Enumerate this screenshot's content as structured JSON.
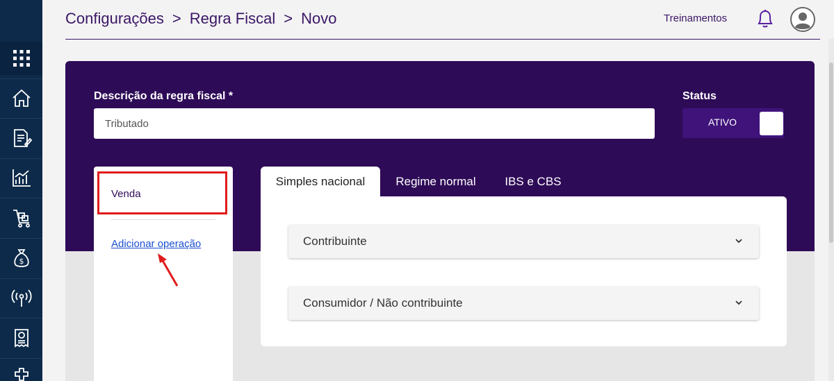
{
  "sidebar": {
    "items": [
      {
        "icon": "apps-grid-icon"
      },
      {
        "icon": "home-icon"
      },
      {
        "icon": "document-edit-icon"
      },
      {
        "icon": "analytics-chart-icon"
      },
      {
        "icon": "cart-icon"
      },
      {
        "icon": "money-bag-icon"
      },
      {
        "icon": "broadcast-antenna-icon"
      },
      {
        "icon": "receipt-icon"
      },
      {
        "icon": "puzzle-icon"
      }
    ]
  },
  "header": {
    "breadcrumb": [
      "Configurações",
      "Regra Fiscal",
      "Novo"
    ],
    "separator": ">",
    "treinamentos": "Treinamentos",
    "bell_icon": "bell-icon",
    "avatar_icon": "user-avatar-icon"
  },
  "form": {
    "description_label": "Descrição da regra fiscal *",
    "description_value": "Tributado",
    "status_label": "Status",
    "status_value": "ATIVO"
  },
  "operations": {
    "items": [
      "Venda"
    ],
    "add_label": "Adicionar operação"
  },
  "tabs": [
    {
      "label": "Simples nacional",
      "active": true
    },
    {
      "label": "Regime normal",
      "active": false
    },
    {
      "label": "IBS e CBS",
      "active": false
    }
  ],
  "accordions": [
    {
      "label": "Contribuinte"
    },
    {
      "label": "Consumidor / Não contribuinte"
    }
  ],
  "colors": {
    "sidebar": "#0d2a4a",
    "brand_purple": "#2e0b57",
    "highlight": "#e11b1b",
    "link": "#1a4fd0"
  }
}
